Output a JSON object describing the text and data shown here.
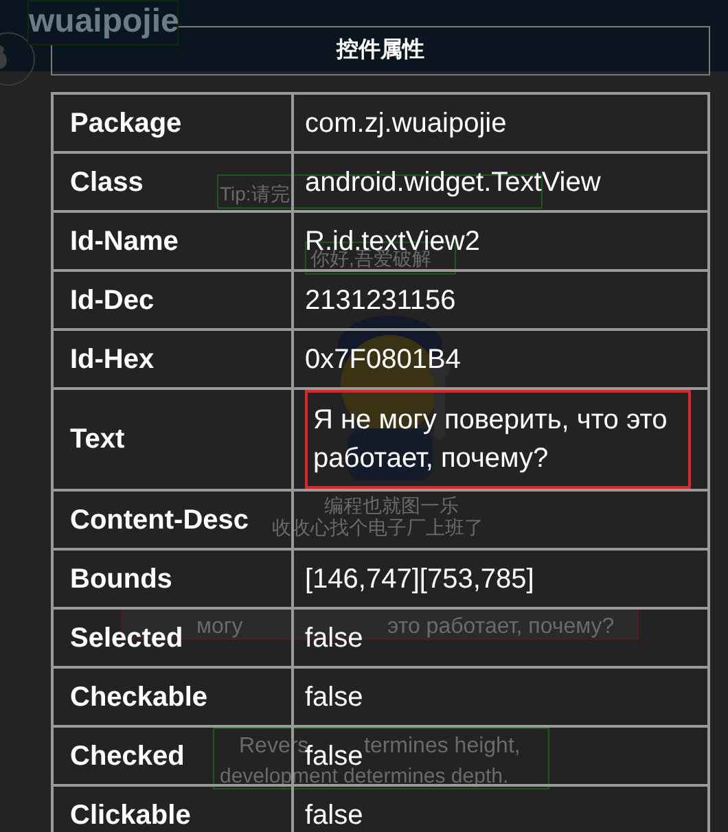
{
  "background_app": {
    "logo": "wuaipojie",
    "texts": [
      {
        "kind": "tip",
        "text": "Tip:请完"
      },
      {
        "kind": "hello",
        "text": "你好,吾爱破解"
      },
      {
        "kind": "line1",
        "text": "编程也就图一乐"
      },
      {
        "kind": "line2",
        "text": "收收心找个电子厂上班了"
      },
      {
        "kind": "russian_a",
        "text": "могу"
      },
      {
        "kind": "russian_b",
        "text": "это работает, почему?"
      },
      {
        "kind": "motto_a",
        "text": "Revers"
      },
      {
        "kind": "motto_b",
        "text": "termines height,"
      },
      {
        "kind": "motto_c",
        "text": "development determines depth."
      }
    ]
  },
  "dialog": {
    "title": "控件属性",
    "rows": [
      {
        "label": "Package",
        "value": "com.zj.wuaipojie",
        "highlighted": false
      },
      {
        "label": "Class",
        "value": "android.widget.TextView",
        "highlighted": false
      },
      {
        "label": "Id-Name",
        "value": "R.id.textView2",
        "highlighted": false
      },
      {
        "label": "Id-Dec",
        "value": "2131231156",
        "highlighted": false
      },
      {
        "label": "Id-Hex",
        "value": "0x7F0801B4",
        "highlighted": false
      },
      {
        "label": "Text",
        "value": "Я не могу поверить, что это работает, почему?",
        "highlighted": true
      },
      {
        "label": "Content-Desc",
        "highlighted": false
      },
      {
        "label": "Bounds",
        "value": "[146,747][753,785]",
        "highlighted": false
      },
      {
        "label": "Selected",
        "value": "false",
        "highlighted": false
      },
      {
        "label": "Checkable",
        "value": "false",
        "highlighted": false
      },
      {
        "label": "Checked",
        "value": "false",
        "highlighted": false
      },
      {
        "label": "Clickable",
        "value": "false",
        "highlighted": false
      }
    ]
  }
}
